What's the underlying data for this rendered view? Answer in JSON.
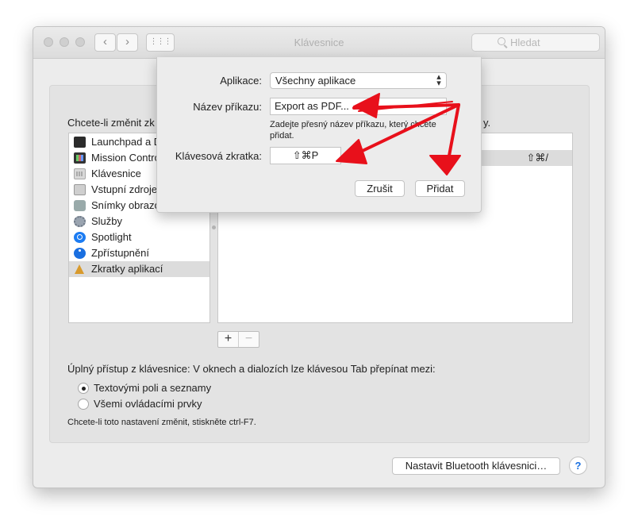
{
  "window": {
    "title": "Klávesnice",
    "search_placeholder": "Hledat",
    "nav_back": "‹",
    "nav_forward": "›",
    "grid_icon": "⋮⋮⋮"
  },
  "prompt": {
    "text": "Chcete-li změnit zk",
    "tail": "y."
  },
  "sidebar": {
    "items": [
      {
        "label": "Launchpad a Dock",
        "icon": "launchpad-icon"
      },
      {
        "label": "Mission Control",
        "icon": "mission-control-icon"
      },
      {
        "label": "Klávesnice",
        "icon": "keyboard-icon"
      },
      {
        "label": "Vstupní zdroje",
        "icon": "input-sources-icon"
      },
      {
        "label": "Snímky obrazovky",
        "icon": "screenshot-icon"
      },
      {
        "label": "Služby",
        "icon": "services-gear-icon"
      },
      {
        "label": "Spotlight",
        "icon": "spotlight-icon"
      },
      {
        "label": "Zpřístupnění",
        "icon": "accessibility-icon"
      },
      {
        "label": "Zkratky aplikací",
        "icon": "app-shortcuts-icon",
        "selected": true
      }
    ]
  },
  "shortcut_table": {
    "selected_row_keys": "⇧⌘/"
  },
  "controls": {
    "plus": "+",
    "minus": "−"
  },
  "keyboard_access": {
    "text": "Úplný přístup z klávesnice: V oknech a dialozích lze klávesou Tab přepínat mezi:",
    "options": [
      {
        "label": "Textovými poli a seznamy",
        "checked": true
      },
      {
        "label": "Všemi ovládacími prvky",
        "checked": false
      }
    ],
    "hint": "Chcete-li toto nastavení změnit, stiskněte ctrl-F7."
  },
  "bottom": {
    "bluetooth_button": "Nastavit Bluetooth klávesnici…",
    "help": "?"
  },
  "sheet": {
    "app_label": "Aplikace:",
    "app_value": "Všechny aplikace",
    "cmd_label": "Název příkazu:",
    "cmd_value": "Export as PDF...",
    "note": "Zadejte přesný název příkazu, který chcete přidat.",
    "shortcut_label": "Klávesová zkratka:",
    "shortcut_value": "⇧⌘P",
    "cancel": "Zrušit",
    "add": "Přidat"
  },
  "colors": {
    "annotation": "#e8101b",
    "accent": "#1a6fe0"
  }
}
